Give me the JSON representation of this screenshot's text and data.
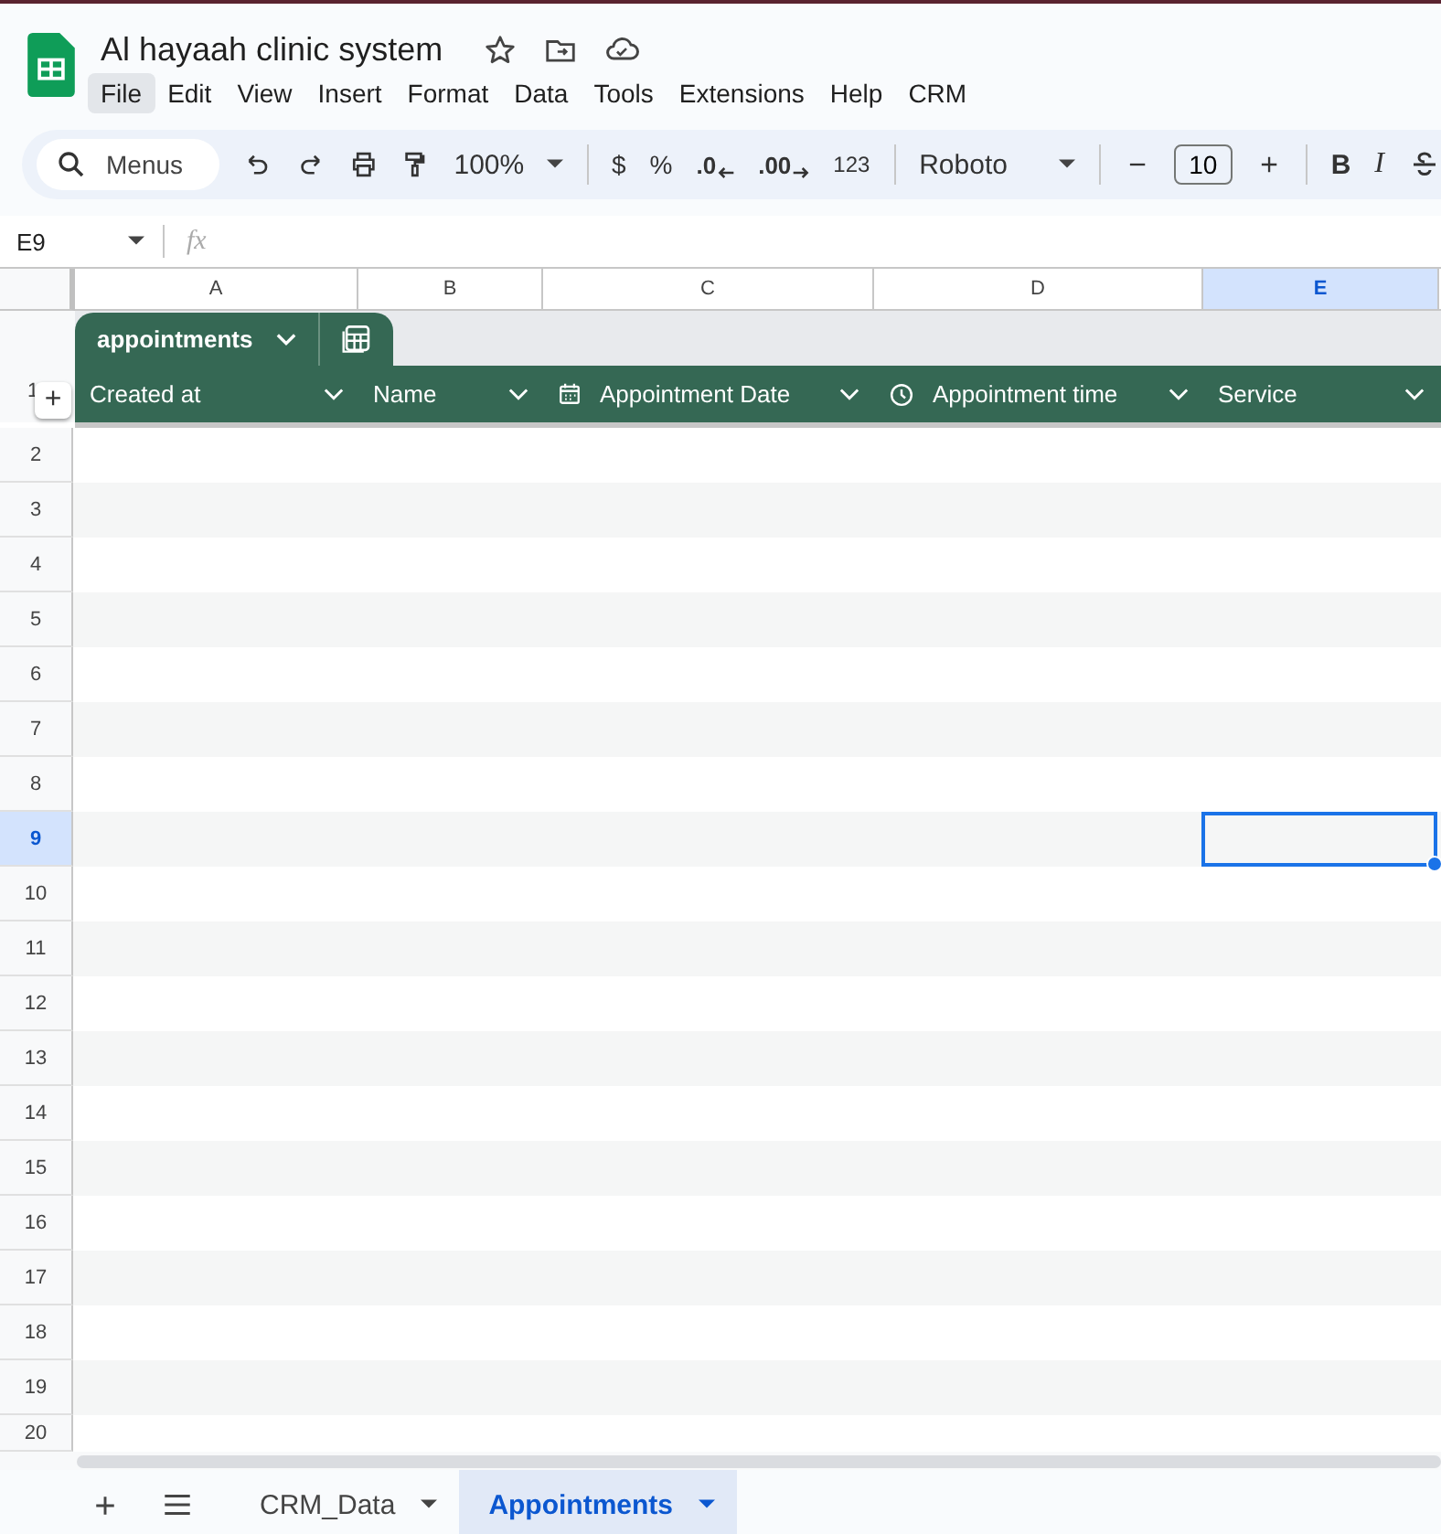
{
  "document": {
    "title": "Al hayaah clinic system"
  },
  "menu": [
    {
      "label": "File",
      "selected": true
    },
    {
      "label": "Edit",
      "selected": false
    },
    {
      "label": "View",
      "selected": false
    },
    {
      "label": "Insert",
      "selected": false
    },
    {
      "label": "Format",
      "selected": false
    },
    {
      "label": "Data",
      "selected": false
    },
    {
      "label": "Tools",
      "selected": false
    },
    {
      "label": "Extensions",
      "selected": false
    },
    {
      "label": "Help",
      "selected": false
    },
    {
      "label": "CRM",
      "selected": false
    }
  ],
  "toolbar": {
    "search": {
      "placeholder": "Menus"
    },
    "zoom": "100%",
    "currency": "$",
    "percent": "%",
    "decrease_decimal": ".0",
    "increase_decimal": ".00",
    "number_format": "123",
    "font": "Roboto",
    "font_size": "10",
    "bold": "B",
    "italic": "I"
  },
  "name_box": "E9",
  "formula_label": "fx",
  "columns": [
    {
      "label": "A",
      "selected": false
    },
    {
      "label": "B",
      "selected": false
    },
    {
      "label": "C",
      "selected": false
    },
    {
      "label": "D",
      "selected": false
    },
    {
      "label": "E",
      "selected": true
    }
  ],
  "table": {
    "name": "appointments",
    "header_row": "1",
    "add_symbol": "+",
    "headers": [
      {
        "label": "Created at",
        "kind": "text"
      },
      {
        "label": "Name",
        "kind": "text"
      },
      {
        "label": "Appointment Date",
        "kind": "date"
      },
      {
        "label": "Appointment time",
        "kind": "time"
      },
      {
        "label": "Service",
        "kind": "text"
      }
    ]
  },
  "rows": [
    {
      "label": "2",
      "selected": false
    },
    {
      "label": "3",
      "selected": false
    },
    {
      "label": "4",
      "selected": false
    },
    {
      "label": "5",
      "selected": false
    },
    {
      "label": "6",
      "selected": false
    },
    {
      "label": "7",
      "selected": false
    },
    {
      "label": "8",
      "selected": false
    },
    {
      "label": "9",
      "selected": true
    },
    {
      "label": "10",
      "selected": false
    },
    {
      "label": "11",
      "selected": false
    },
    {
      "label": "12",
      "selected": false
    },
    {
      "label": "13",
      "selected": false
    },
    {
      "label": "14",
      "selected": false
    },
    {
      "label": "15",
      "selected": false
    },
    {
      "label": "16",
      "selected": false
    },
    {
      "label": "17",
      "selected": false
    },
    {
      "label": "18",
      "selected": false
    },
    {
      "label": "19",
      "selected": false
    },
    {
      "label": "20",
      "selected": false
    }
  ],
  "sheet_tabs": [
    {
      "label": "CRM_Data",
      "selected": false
    },
    {
      "label": "Appointments",
      "selected": true
    }
  ]
}
